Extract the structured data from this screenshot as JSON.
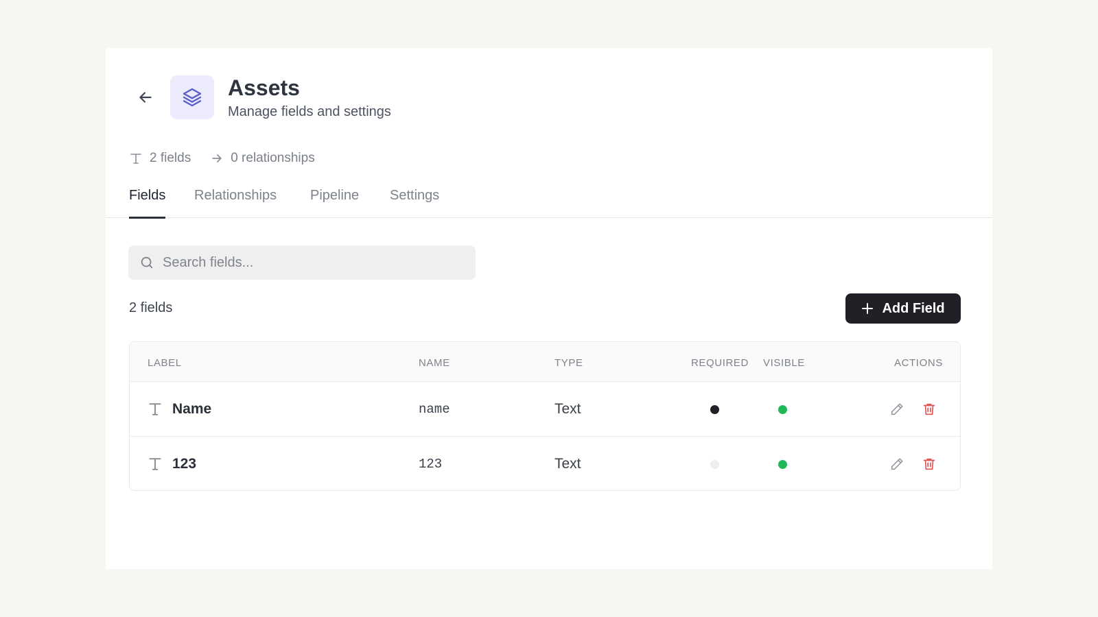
{
  "header": {
    "title": "Assets",
    "subtitle": "Manage fields and settings",
    "back_icon": "arrow-left-icon",
    "entity_icon": "layers-icon",
    "entity_icon_bg": "#ecebfb",
    "entity_icon_color": "#5b5fc7"
  },
  "stats": {
    "fields": "2 fields",
    "relationships": "0 relationships"
  },
  "tabs": [
    {
      "label": "Fields",
      "active": true
    },
    {
      "label": "Relationships",
      "active": false
    },
    {
      "label": "Pipeline",
      "active": false
    },
    {
      "label": "Settings",
      "active": false
    }
  ],
  "search": {
    "placeholder": "Search fields...",
    "value": ""
  },
  "list": {
    "count": "2 fields",
    "add_button": "Add Field"
  },
  "table": {
    "headers": {
      "label": "LABEL",
      "name": "NAME",
      "type": "TYPE",
      "required": "REQUIRED",
      "visible": "VISIBLE",
      "actions": "ACTIONS"
    },
    "rows": [
      {
        "label": "Name",
        "name": "name",
        "type": "Text",
        "required": true,
        "visible": true
      },
      {
        "label": "123",
        "name": "123",
        "type": "Text",
        "required": false,
        "visible": true
      }
    ]
  },
  "colors": {
    "required_on": "#1f2126",
    "required_off": "#eeeeee",
    "visible_on": "#22b85a",
    "delete": "#e05252",
    "edit": "#8a8f98",
    "primary_button": "#1f2126"
  }
}
